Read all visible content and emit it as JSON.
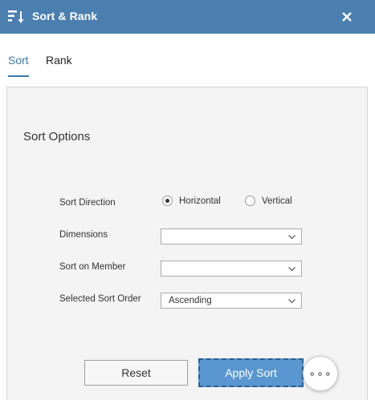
{
  "window": {
    "title": "Sort & Rank",
    "icon": "sort-descending-icon",
    "close_icon": "close-icon",
    "accent_color": "#4a7fb0"
  },
  "tabs": [
    {
      "label": "Sort",
      "active": true
    },
    {
      "label": "Rank",
      "active": false
    }
  ],
  "panel": {
    "title": "Sort Options",
    "sort_direction": {
      "label": "Sort Direction",
      "options": [
        {
          "label": "Horizontal",
          "selected": true
        },
        {
          "label": "Vertical",
          "selected": false
        }
      ]
    },
    "dimensions": {
      "label": "Dimensions",
      "value": ""
    },
    "sort_on_member": {
      "label": "Sort on Member",
      "value": ""
    },
    "selected_sort_order": {
      "label": "Selected Sort Order",
      "value": "Ascending"
    }
  },
  "buttons": {
    "reset": "Reset",
    "apply": "Apply Sort",
    "more": "∘∘∘"
  }
}
